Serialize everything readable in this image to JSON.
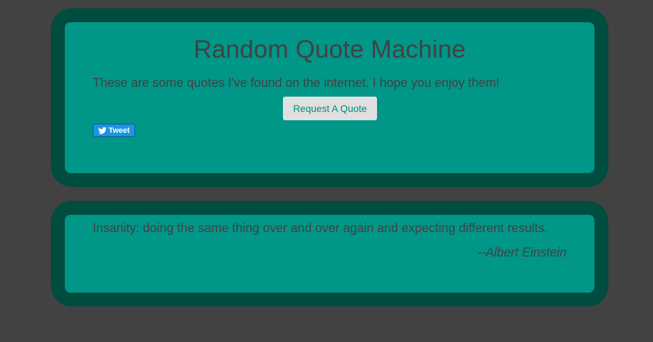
{
  "header": {
    "title": "Random Quote Machine",
    "intro": "These are some quotes I've found on the internet. I hope you enjoy them!",
    "request_button_label": "Request A Quote",
    "tweet_button_label": "Tweet",
    "tweet_icon": "twitter-bird-icon"
  },
  "quote": {
    "text": "Insanity: doing the same thing over and over again and expecting different results.",
    "author": "--Albert Einstein"
  },
  "colors": {
    "page_background": "#424242",
    "frame": "#004d40",
    "panel": "#009688",
    "text": "#424242",
    "button_background": "#e0e0e0",
    "button_text": "#00897b",
    "tweet_background": "#1b95e0"
  }
}
